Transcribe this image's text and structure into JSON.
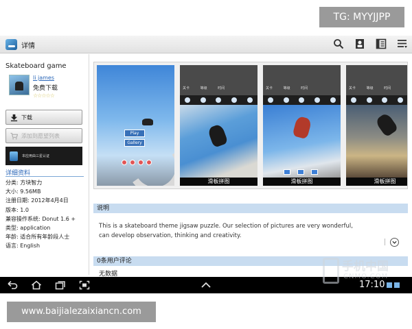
{
  "watermarks": {
    "top": "TG: MYYJJPP",
    "bottom": "www.baijialezaixiancn.com",
    "site_cn": "手机中国",
    "site_en": "CNMO.COM"
  },
  "actionbar": {
    "title": "详情",
    "icons": [
      "search-icon",
      "contacts-icon",
      "book-icon",
      "menu-icon"
    ]
  },
  "app": {
    "name": "Skateboard game",
    "author": "li james",
    "price": "免费下载",
    "stars": "☆☆☆☆☆",
    "download_label": "下载",
    "wishlist_label": "添加到愿望列表",
    "banner_text": "本应用由三星认证"
  },
  "details": {
    "title": "详细资料",
    "lines": [
      "分类: 方块智力",
      "大小: 9.56MB",
      "注册日期: 2012年4月4日",
      "版本: 1.0",
      "兼容操作系统: Donut 1.6 +",
      "类型: application",
      "年龄: 适合所有年龄段人士",
      "语言: English"
    ]
  },
  "screenshots": {
    "shot1": {
      "play": "Play",
      "gallery": "Gallery"
    },
    "puzzle_tabs": "关卡 等级 时间",
    "captions": [
      "滑板拼图",
      "滑板拼图",
      "滑板拼图"
    ]
  },
  "description": {
    "heading": "说明",
    "line1": "This is a skateboard theme jigsaw puzzle. Our selection of pictures are very wonderful,",
    "line2": "can develop observation, thinking and creativity."
  },
  "reviews": {
    "heading": "0条用户评论",
    "no_data": "无数据"
  },
  "navbar": {
    "time": "17:10"
  },
  "colors": {
    "link": "#2b67b8",
    "section_header": "#c8dcf0",
    "navbar": "#000000"
  }
}
